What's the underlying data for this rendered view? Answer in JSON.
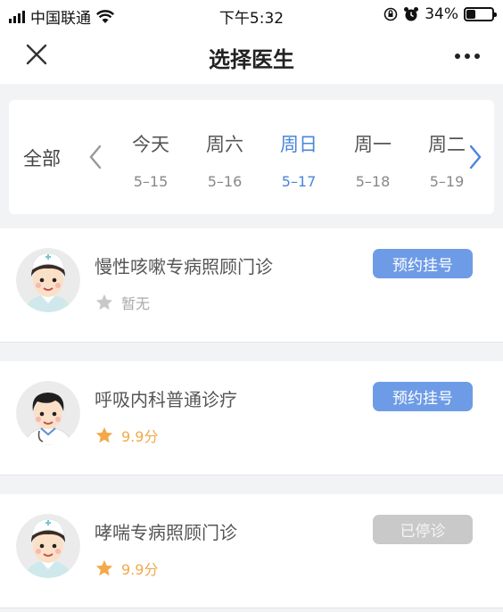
{
  "status_bar": {
    "carrier": "中国联通",
    "time": "下午5:32",
    "battery": "34%",
    "battery_level": 0.34
  },
  "nav": {
    "title": "选择医生"
  },
  "date_filter": {
    "all_label": "全部",
    "days": [
      {
        "weekday": "今天",
        "date": "5-15"
      },
      {
        "weekday": "周六",
        "date": "5-16"
      },
      {
        "weekday": "周日",
        "date": "5-17",
        "active": true
      },
      {
        "weekday": "周一",
        "date": "5-18"
      },
      {
        "weekday": "周二",
        "date": "5-19"
      }
    ]
  },
  "doctors": [
    {
      "name": "慢性咳嗽专病照顾门诊",
      "rating": "暂无",
      "has_rating": false,
      "action": "预约挂号",
      "status": "book",
      "avatar": "nurse-avatar"
    },
    {
      "name": "呼吸内科普通诊疗",
      "rating": "9.9分",
      "has_rating": true,
      "action": "预约挂号",
      "status": "book",
      "avatar": "doctor-avatar"
    },
    {
      "name": "哮喘专病照顾门诊",
      "rating": "9.9分",
      "has_rating": true,
      "action": "已停诊",
      "status": "stopped",
      "avatar": "nurse-avatar"
    }
  ],
  "colors": {
    "accent": "#4a86d8",
    "button": "#6e9be6",
    "disabled": "#c9c9c9",
    "star": "#f3a94a",
    "star_empty": "#c8c8c8"
  }
}
